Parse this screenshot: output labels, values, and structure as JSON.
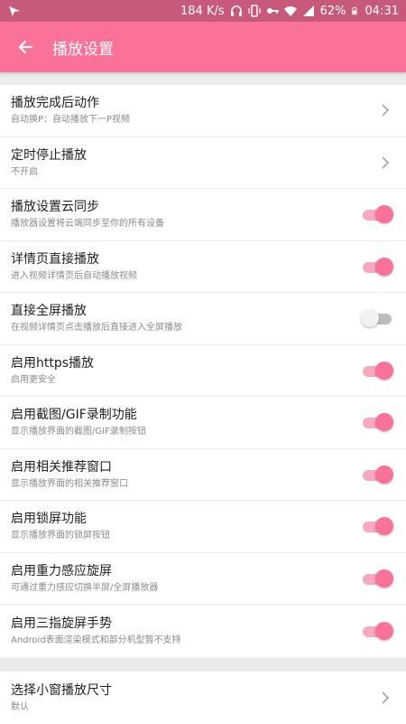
{
  "status_bar": {
    "network_speed": "184 K/s",
    "battery": "62%",
    "time": "04:31"
  },
  "toolbar": {
    "title": "播放设置"
  },
  "settings": [
    {
      "title": "播放完成后动作",
      "subtitle": "自动换P：自动播放下一P视频",
      "control": "chevron"
    },
    {
      "title": "定时停止播放",
      "subtitle": "不开启",
      "control": "chevron"
    },
    {
      "title": "播放设置云同步",
      "subtitle": "播放器设置将云端同步至你的所有设备",
      "control": "toggle",
      "on": true
    },
    {
      "title": "详情页直接播放",
      "subtitle": "进入视频详情页后自动播放视频",
      "control": "toggle",
      "on": true
    },
    {
      "title": "直接全屏播放",
      "subtitle": "在视频详情页点击播放后直接进入全屏播放",
      "control": "toggle",
      "on": false
    },
    {
      "title": "启用https播放",
      "subtitle": "启用更安全",
      "control": "toggle",
      "on": true
    },
    {
      "title": "启用截图/GIF录制功能",
      "subtitle": "显示播放界面的截图/GIF录制按钮",
      "control": "toggle",
      "on": true
    },
    {
      "title": "启用相关推荐窗口",
      "subtitle": "显示播放界面的相关推荐窗口",
      "control": "toggle",
      "on": true
    },
    {
      "title": "启用锁屏功能",
      "subtitle": "显示播放界面的锁屏按钮",
      "control": "toggle",
      "on": true
    },
    {
      "title": "启用重力感应旋屏",
      "subtitle": "可通过重力感应切换半屏/全屏播放器",
      "control": "toggle",
      "on": true
    },
    {
      "title": "启用三指旋屏手势",
      "subtitle": "Android表面渲染模式和部分机型暂不支持",
      "control": "toggle",
      "on": true
    }
  ],
  "settings2": [
    {
      "title": "选择小窗播放尺寸",
      "subtitle": "默认",
      "control": "chevron"
    }
  ],
  "colors": {
    "accent": "#fb7299",
    "status_bar": "#c75a7a"
  }
}
